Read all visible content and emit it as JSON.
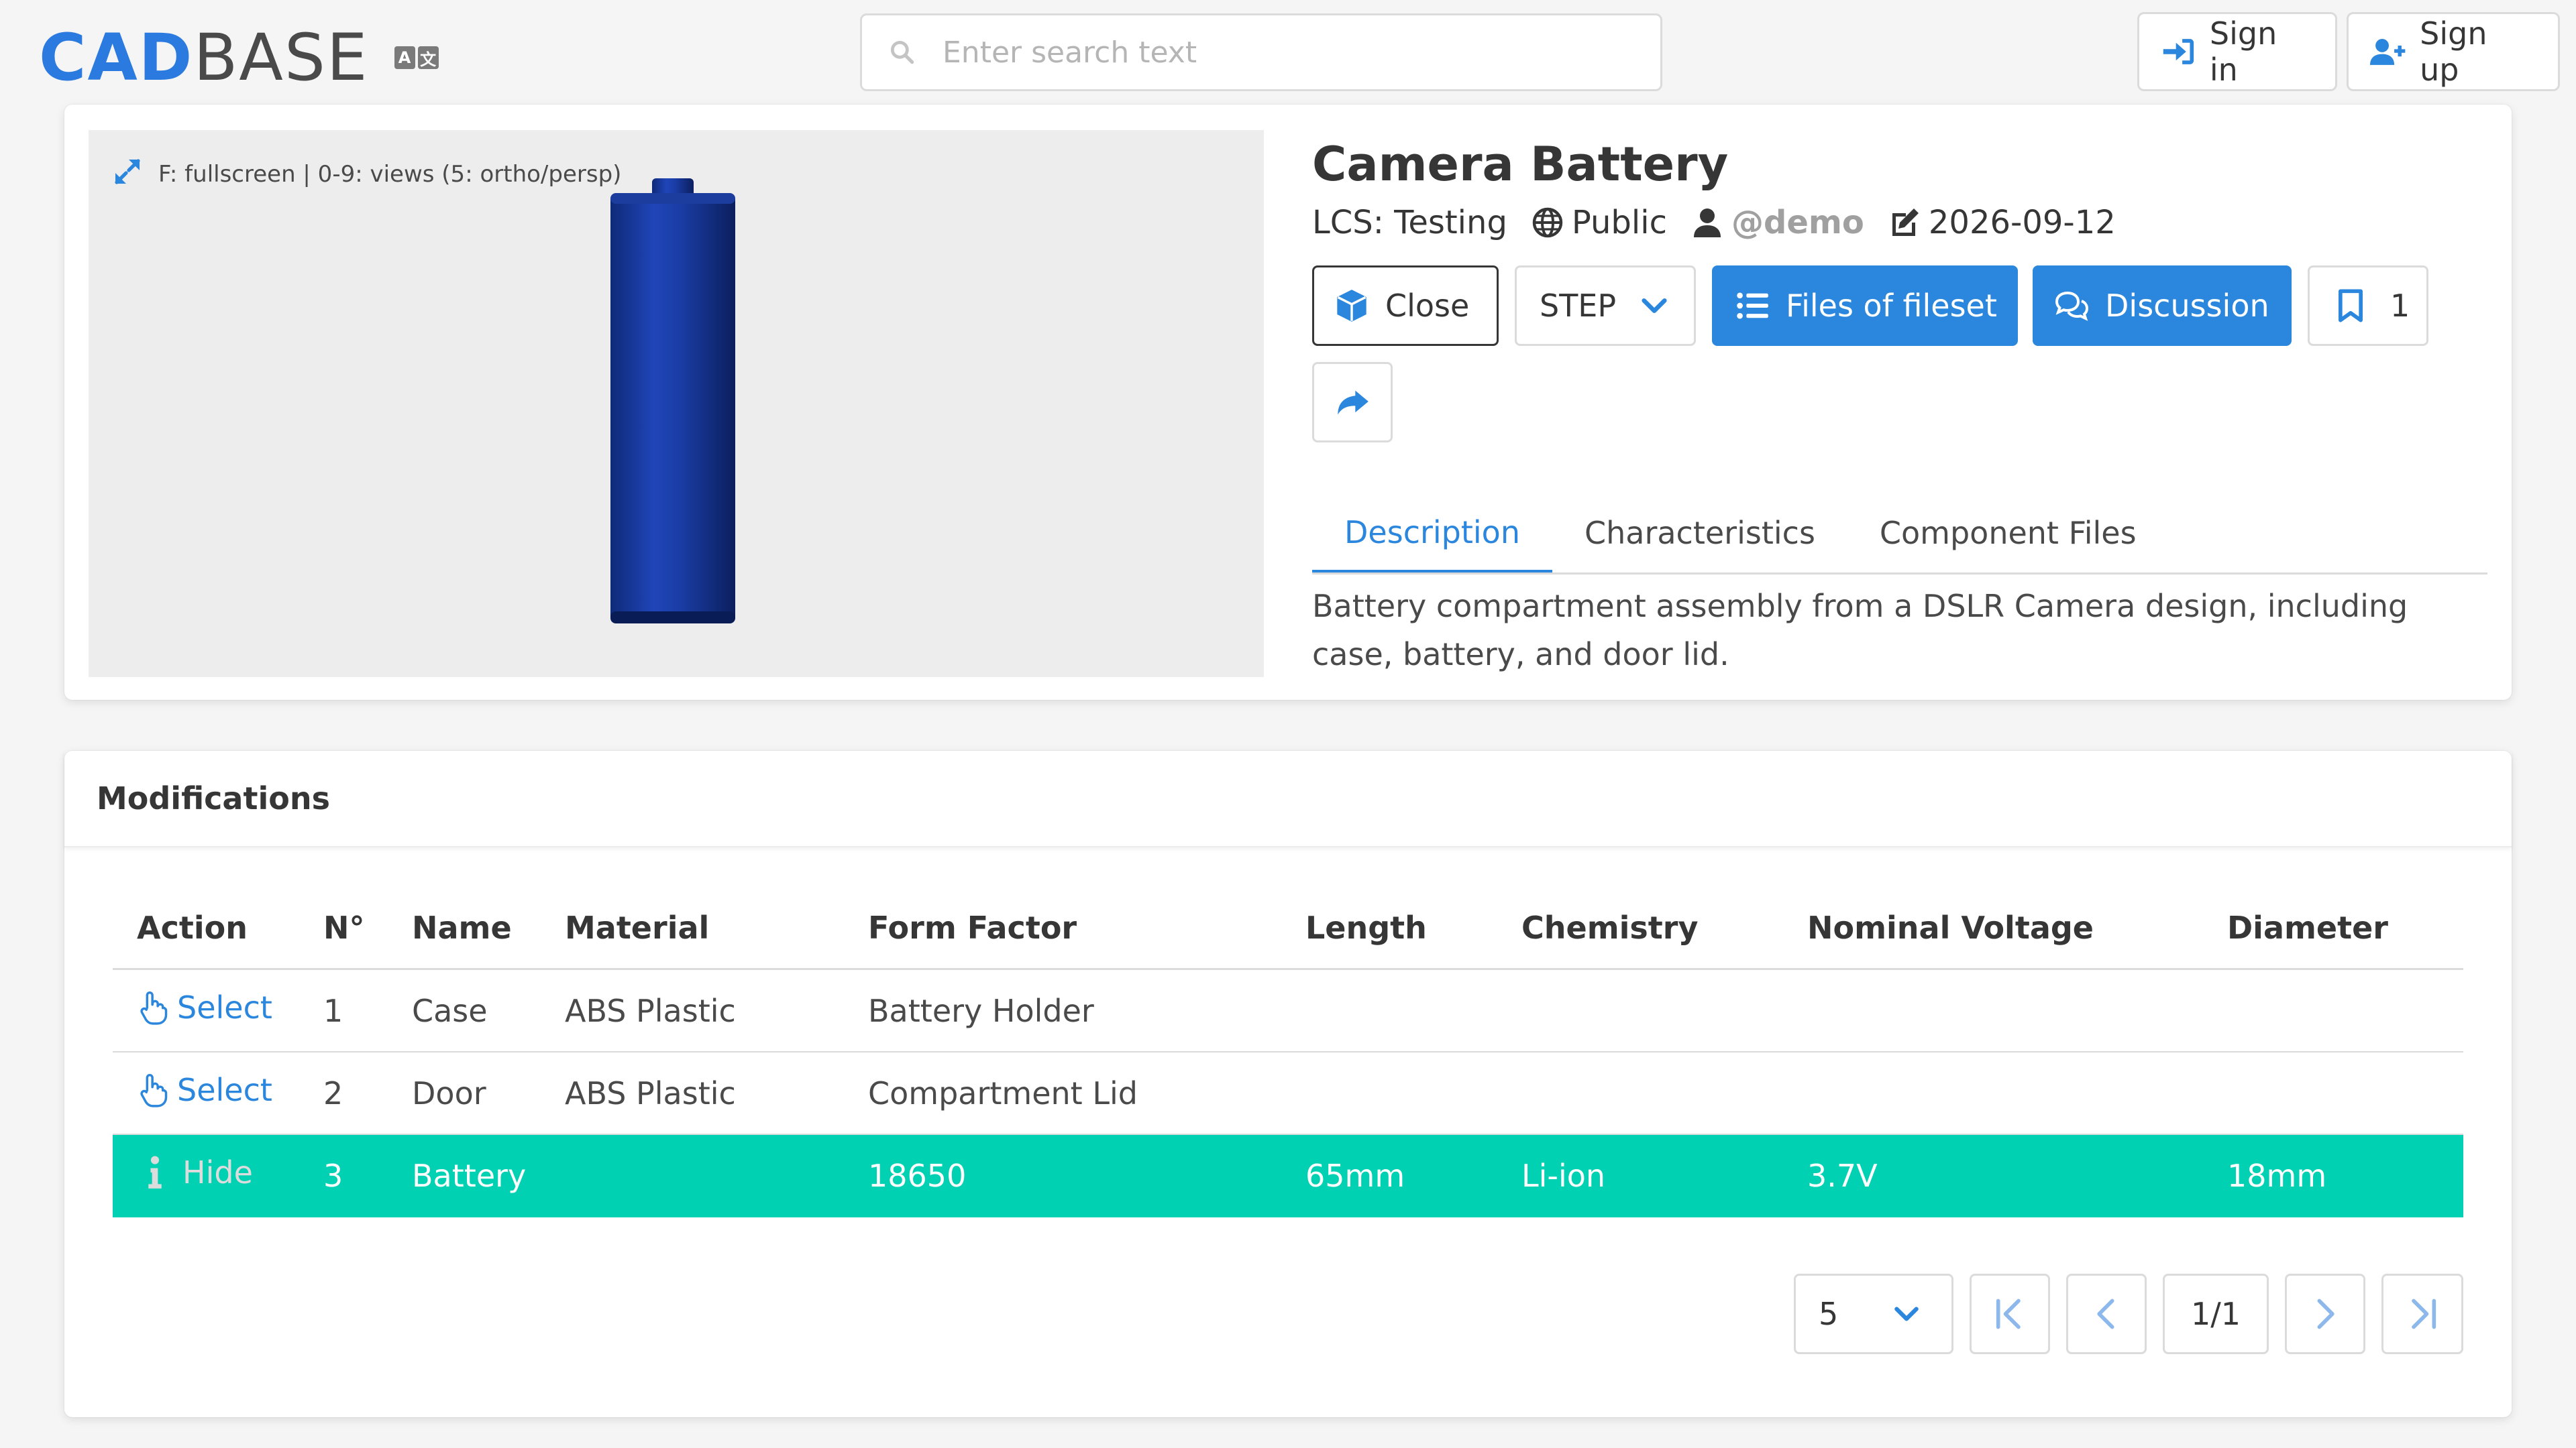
{
  "header": {
    "logo": {
      "part1": "CAD",
      "part2": "BASE"
    },
    "lang_icon": {
      "left": "A",
      "right": "文",
      "name": "translate-icon"
    },
    "search": {
      "placeholder": "Enter search text",
      "value": ""
    },
    "sign_in": "Sign in",
    "sign_up": "Sign up"
  },
  "viewer": {
    "hint": "F: fullscreen | 0-9: views (5: ortho/persp)",
    "model_color": "#1b3a9a"
  },
  "product": {
    "title": "Camera Battery",
    "lcs": "LCS: Testing",
    "visibility": "Public",
    "author": "@demo",
    "date": "2026-09-12",
    "buttons": {
      "close": "Close",
      "format": "STEP",
      "files": "Files of fileset",
      "discussion": "Discussion",
      "bookmarks": "1"
    },
    "tabs": [
      "Description",
      "Characteristics",
      "Component Files"
    ],
    "active_tab": "Description",
    "description": "Battery compartment assembly from a DSLR Camera design, including case, battery, and door lid."
  },
  "modifications": {
    "title": "Modifications",
    "columns": [
      "Action",
      "N°",
      "Name",
      "Material",
      "Form Factor",
      "Length",
      "Chemistry",
      "Nominal Voltage",
      "Diameter"
    ],
    "rows": [
      {
        "action": "Select",
        "no": "1",
        "name": "Case",
        "material": "ABS Plastic",
        "form_factor": "Battery Holder",
        "length": "",
        "chemistry": "",
        "voltage": "",
        "diameter": ""
      },
      {
        "action": "Select",
        "no": "2",
        "name": "Door",
        "material": "ABS Plastic",
        "form_factor": "Compartment Lid",
        "length": "",
        "chemistry": "",
        "voltage": "",
        "diameter": ""
      },
      {
        "action": "Hide",
        "no": "3",
        "name": "Battery",
        "material": "",
        "form_factor": "18650",
        "length": "65mm",
        "chemistry": "Li-ion",
        "voltage": "3.7V",
        "diameter": "18mm"
      }
    ],
    "selected_row": 3,
    "pagination": {
      "page_size": "5",
      "page": "1/1"
    }
  },
  "colors": {
    "accent": "#2b86dd",
    "selected_row": "#00d1b2",
    "background": "#f5f5f5"
  }
}
